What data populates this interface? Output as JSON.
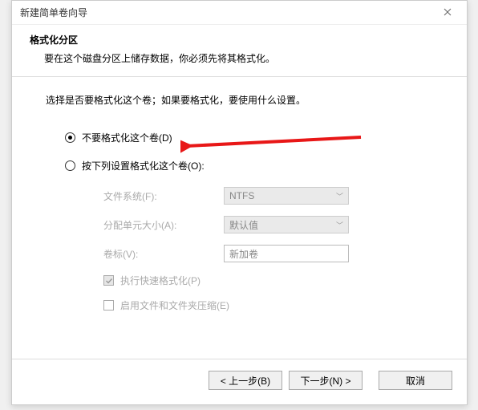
{
  "window": {
    "title": "新建简单卷向导"
  },
  "header": {
    "title": "格式化分区",
    "subtitle": "要在这个磁盘分区上储存数据，你必须先将其格式化。"
  },
  "content": {
    "instruction": "选择是否要格式化这个卷；如果要格式化，要使用什么设置。"
  },
  "radios": {
    "noformat": "不要格式化这个卷(D)",
    "format": "按下列设置格式化这个卷(O):"
  },
  "fields": {
    "filesystem_label": "文件系统(F):",
    "filesystem_value": "NTFS",
    "allocunit_label": "分配单元大小(A):",
    "allocunit_value": "默认值",
    "volumelabel_label": "卷标(V):",
    "volumelabel_value": "新加卷"
  },
  "checkboxes": {
    "quickformat": "执行快速格式化(P)",
    "compression": "启用文件和文件夹压缩(E)"
  },
  "buttons": {
    "back": "< 上一步(B)",
    "next": "下一步(N) >",
    "cancel": "取消"
  }
}
